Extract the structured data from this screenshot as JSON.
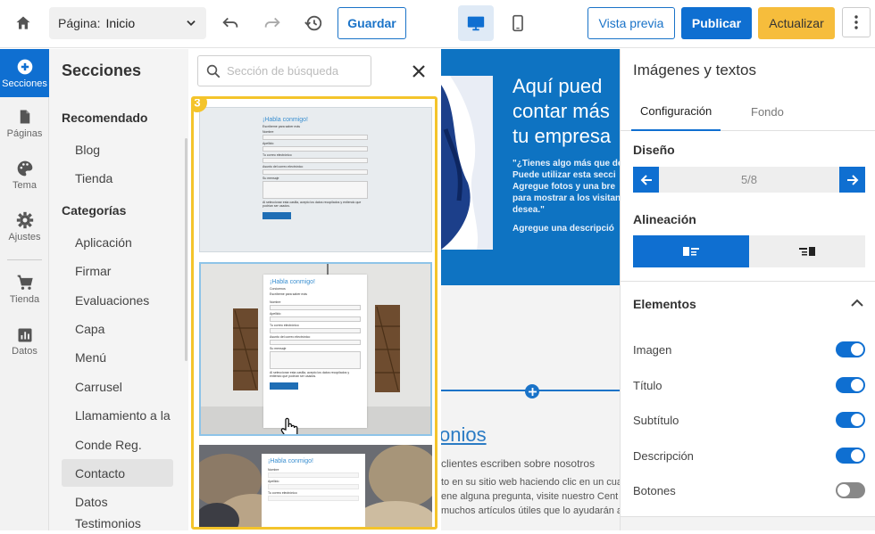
{
  "toolbar": {
    "page_label": "Página:",
    "page_value": "Inicio",
    "save": "Guardar",
    "preview": "Vista previa",
    "publish": "Publicar",
    "update": "Actualizar"
  },
  "rail": [
    {
      "label": "Secciones",
      "icon": "plus-circle-icon",
      "active": true
    },
    {
      "label": "Páginas",
      "icon": "page-icon"
    },
    {
      "label": "Tema",
      "icon": "palette-icon"
    },
    {
      "label": "Ajustes",
      "icon": "gear-icon"
    },
    {
      "label": "Tienda",
      "icon": "cart-icon"
    },
    {
      "label": "Datos",
      "icon": "chart-icon"
    }
  ],
  "sections": {
    "title": "Secciones",
    "recommended_label": "Recomendado",
    "recommended": [
      "Blog",
      "Tienda"
    ],
    "categories_label": "Categorías",
    "categories": [
      "Aplicación",
      "Firmar",
      "Evaluaciones",
      "Capa",
      "Menú",
      "Carrusel",
      "Llamamiento a la ...",
      "Conde Reg.",
      "Contacto",
      "Datos",
      "Testimonios"
    ],
    "active": "Contacto"
  },
  "gallery": {
    "search_placeholder": "Sección de búsqueda",
    "step_badge": "3",
    "form_title": "¡Habla conmigo!",
    "form_subtitle": "Conócenos",
    "form_desc": "Escríbeme para saber más",
    "fields": [
      "Nombre",
      "Apellido",
      "Tu correo electrónico",
      "Asunto del correo electrónico",
      "Su mensaje"
    ],
    "consent": "Al seleccionar esta casilla, acepto los datos recopilados y entiendo que podrían ser usados.",
    "button": "Enviar mensaje"
  },
  "preview": {
    "hero_heading": [
      "Aquí pued",
      "contar más",
      "tu empresa"
    ],
    "hero_text": [
      "\"¿Tienes algo más que de",
      "Puede utilizar esta secci",
      "Agregue fotos y una bre",
      "para mostrar a los visitan",
      "desea.\""
    ],
    "hero_text2": "Agregue una descripció",
    "testimonials_title": "onios",
    "testimonials_sub": "clientes escriben sobre nosotros",
    "testimonials_body": [
      "to en su sitio web haciendo clic en un cua",
      "ene alguna pregunta, visite nuestro Cent",
      "muchos artículos útiles que lo ayudarán a"
    ]
  },
  "panel": {
    "title": "Imágenes y textos",
    "tab_config": "Configuración",
    "tab_bg": "Fondo",
    "design_label": "Diseño",
    "design_value": "5/8",
    "align_label": "Alineación",
    "elements_label": "Elementos",
    "elements": [
      {
        "label": "Imagen",
        "on": true
      },
      {
        "label": "Título",
        "on": true
      },
      {
        "label": "Subtítulo",
        "on": true
      },
      {
        "label": "Descripción",
        "on": true
      },
      {
        "label": "Botones",
        "on": false
      }
    ]
  },
  "colors": {
    "accent": "#0f6fd1",
    "highlight": "#f4c42b",
    "update": "#f6bd3c"
  }
}
